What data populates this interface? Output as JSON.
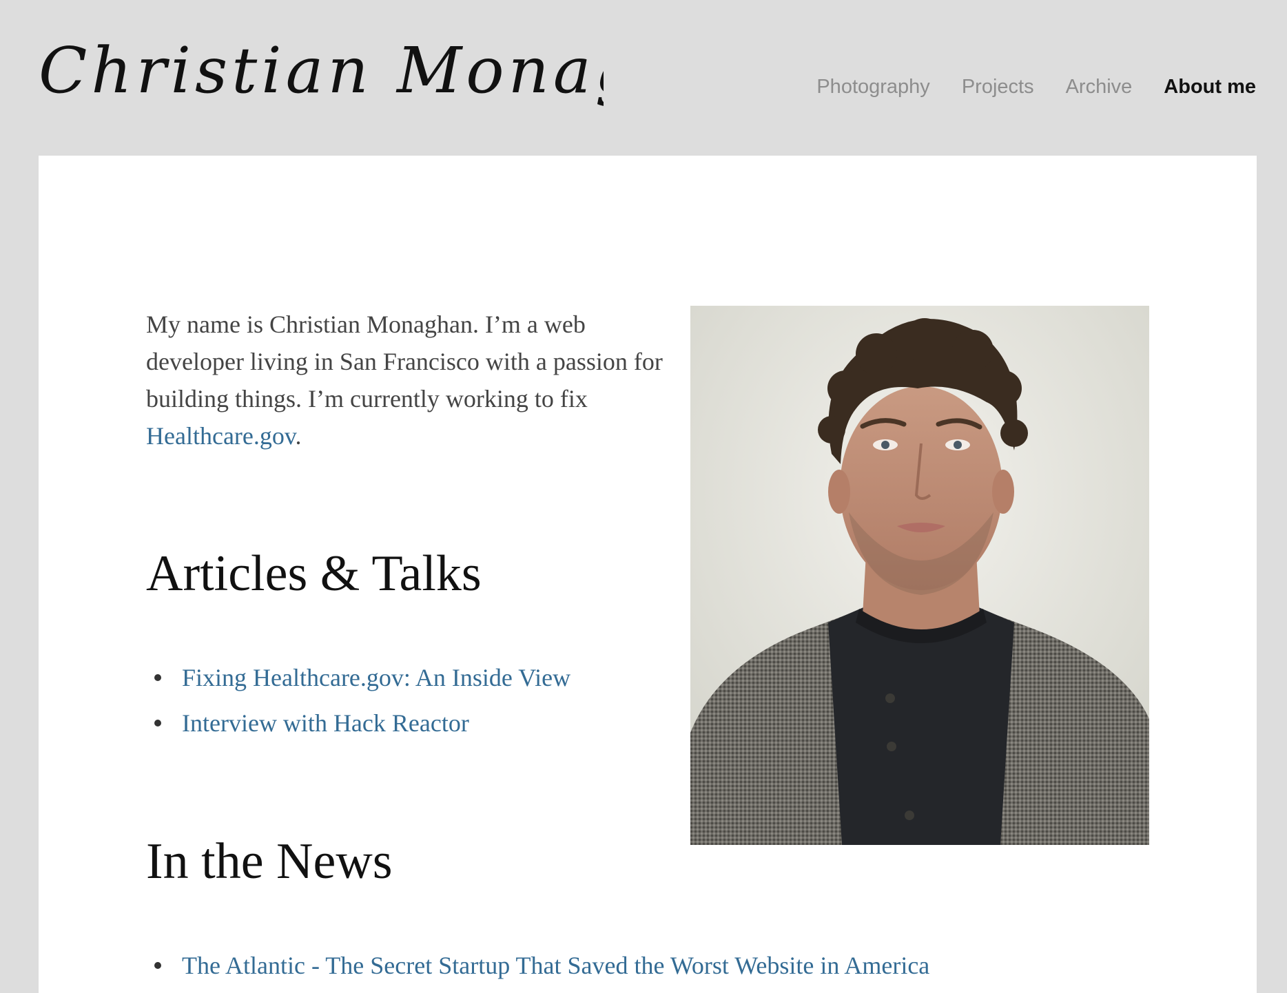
{
  "site": {
    "title": "Christian Monaghan"
  },
  "nav": {
    "items": [
      {
        "label": "Photography",
        "active": false
      },
      {
        "label": "Projects",
        "active": false
      },
      {
        "label": "Archive",
        "active": false
      },
      {
        "label": "About me",
        "active": true
      }
    ]
  },
  "intro": {
    "text": "My name is Christian Monaghan. I’m a web developer living in San Francisco with a passion for building things. I’m currently working to fix ",
    "link": "Healthcare.gov",
    "after": "."
  },
  "articles": {
    "heading": "Articles & Talks",
    "items": [
      "Fixing Healthcare.gov: An Inside View",
      "Interview with Hack Reactor"
    ]
  },
  "news": {
    "heading": "In the News",
    "items": [
      "The Atlantic - The Secret Startup That Saved the Worst Website in America"
    ]
  },
  "colors": {
    "page_background": "#dddddd",
    "card_background": "#ffffff",
    "link": "#336b94",
    "nav_inactive": "#8d8d8d",
    "nav_active": "#111111"
  },
  "icons": {
    "bullet": "bullet-dot"
  }
}
